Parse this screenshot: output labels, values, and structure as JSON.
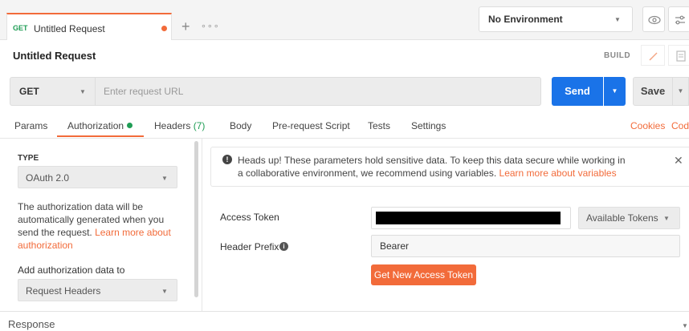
{
  "tabs": {
    "method": "GET",
    "name": "Untitled Request",
    "add": "+",
    "more": "∘∘∘"
  },
  "environment": {
    "selected": "No Environment"
  },
  "request": {
    "title": "Untitled Request",
    "mode": "BUILD",
    "method": "GET",
    "url_placeholder": "Enter request URL",
    "send_label": "Send",
    "save_label": "Save"
  },
  "subtabs": [
    {
      "label": "Params"
    },
    {
      "label": "Authorization"
    },
    {
      "label": "Headers",
      "count": "(7)"
    },
    {
      "label": "Body"
    },
    {
      "label": "Pre-request Script"
    },
    {
      "label": "Tests"
    },
    {
      "label": "Settings"
    }
  ],
  "links": {
    "cookies": "Cookies",
    "code": "Code"
  },
  "auth": {
    "type_label": "TYPE",
    "type_value": "OAuth 2.0",
    "description": "The authorization data will be automatically generated when you send the request.",
    "learn_more": "Learn more about authorization",
    "add_to_label": "Add authorization data to",
    "add_to_value": "Request Headers"
  },
  "alert": {
    "text": "Heads up! These parameters hold sensitive data. To keep this data secure while working in a collaborative environment, we recommend using variables.",
    "link": "Learn more about variables"
  },
  "token": {
    "access_label": "Access Token",
    "available_tokens": "Available Tokens",
    "prefix_label": "Header Prefix",
    "prefix_value": "Bearer",
    "get_new_label": "Get New Access Token"
  },
  "response": {
    "label": "Response"
  },
  "colors": {
    "accent": "#f26b3a",
    "send": "#1a73e8",
    "active_dot": "#1f9d55"
  }
}
